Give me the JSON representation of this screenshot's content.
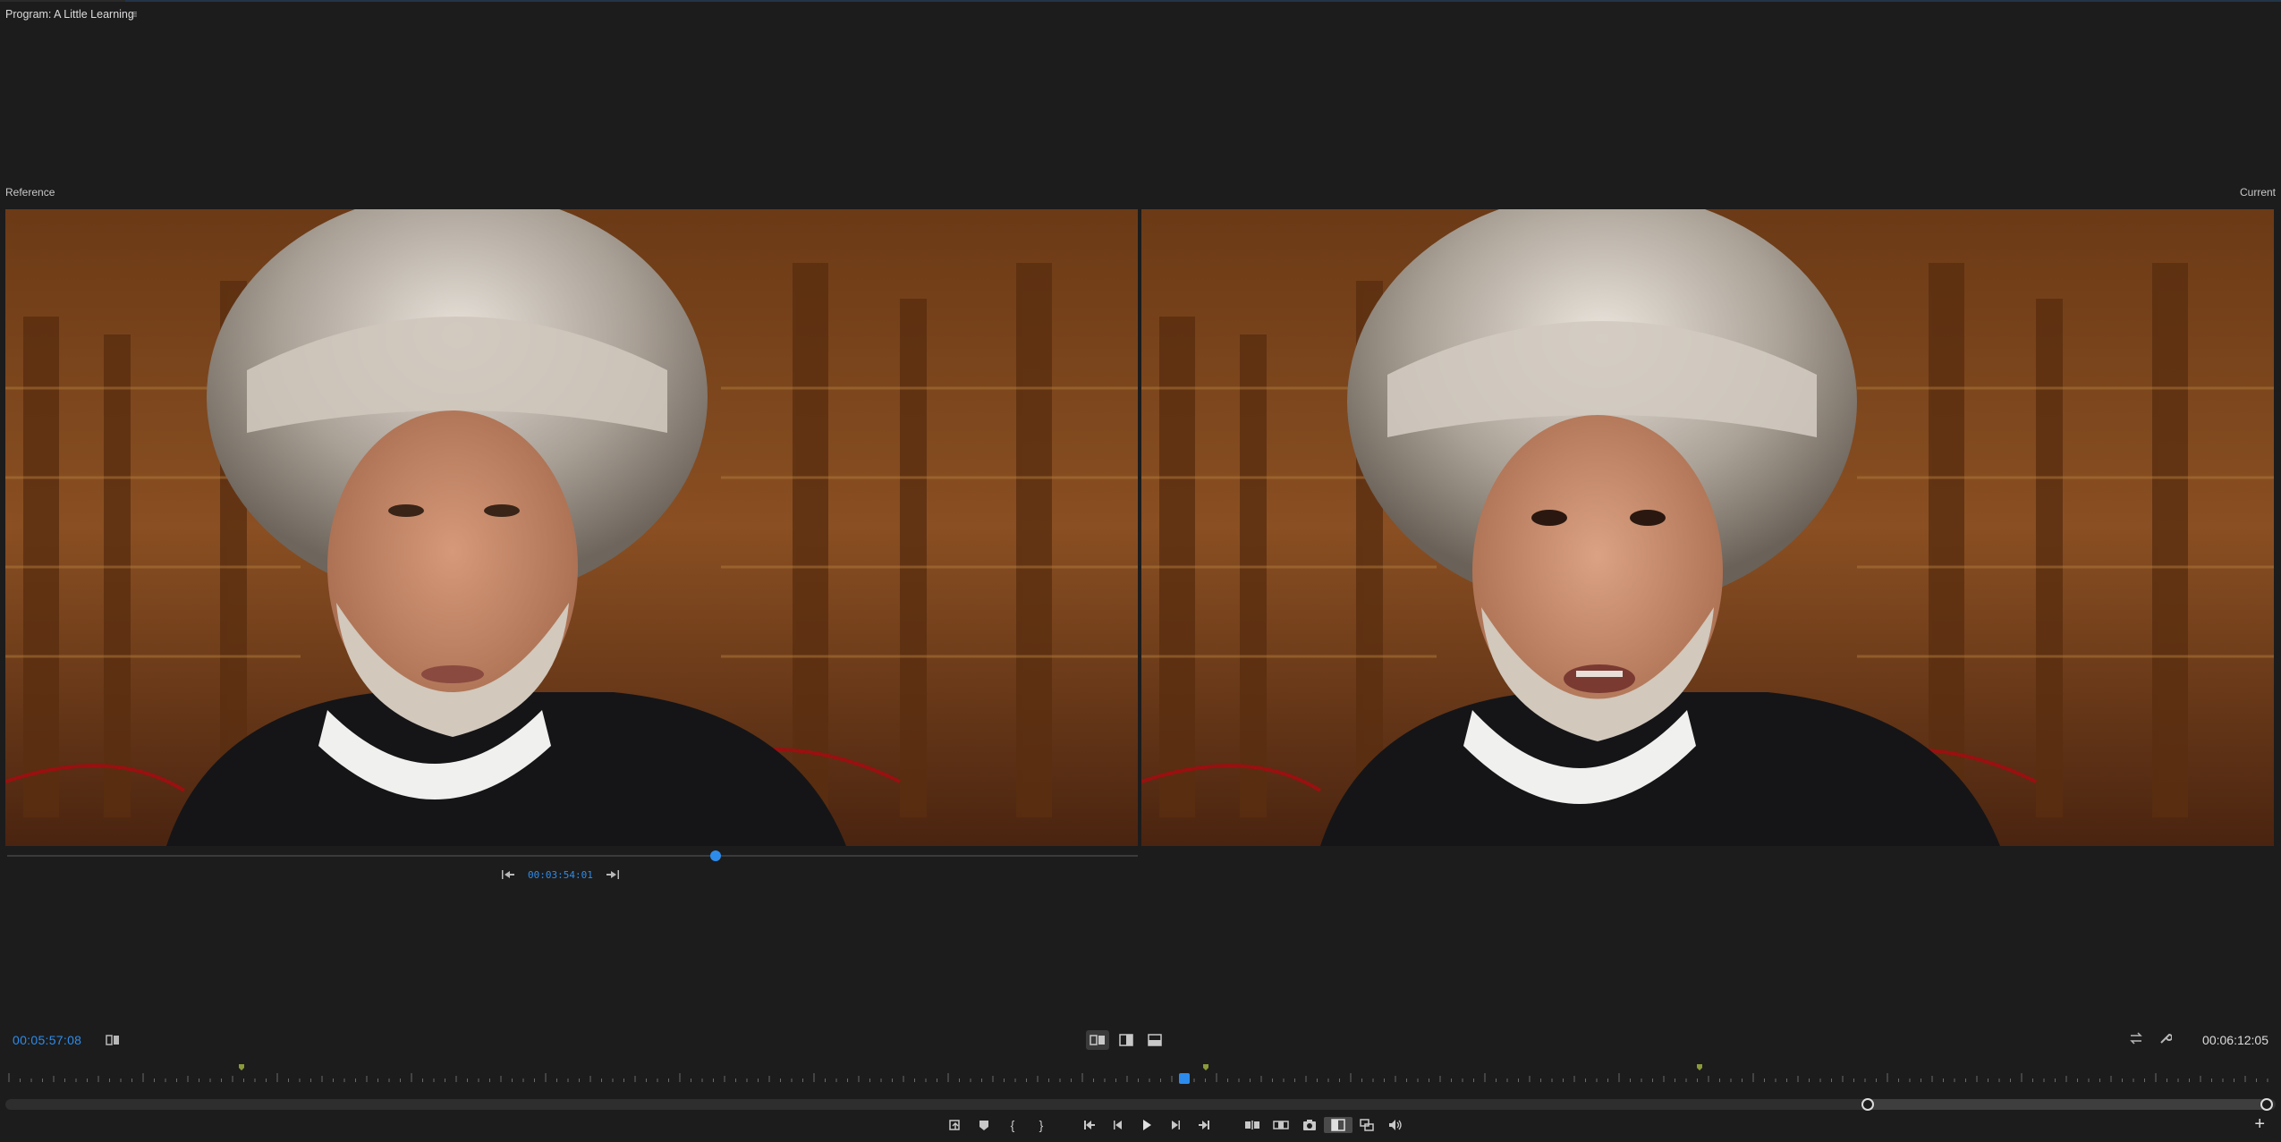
{
  "panel": {
    "title": "Program: A Little Learning",
    "menu_icon": "hamburger-icon"
  },
  "labels": {
    "reference": "Reference",
    "current": "Current"
  },
  "reference_controls": {
    "timecode": "00:03:54:01",
    "scrub_position": 0.62
  },
  "playhead": {
    "timecode": "00:05:57:08"
  },
  "duration": {
    "timecode": "00:06:12:05"
  },
  "compare_modes": [
    {
      "name": "side-by-side",
      "icon": "side-by-side-icon",
      "active": true
    },
    {
      "name": "vertical-split",
      "icon": "vertical-split-icon",
      "active": false
    },
    {
      "name": "horizontal-split",
      "icon": "horizontal-split-icon",
      "active": false
    }
  ],
  "zoom": {
    "start": 0.82,
    "end": 1.0
  },
  "colors": {
    "accent": "#2d8ceb",
    "background": "#1c1c1c",
    "marker": "#8a9a3a"
  }
}
